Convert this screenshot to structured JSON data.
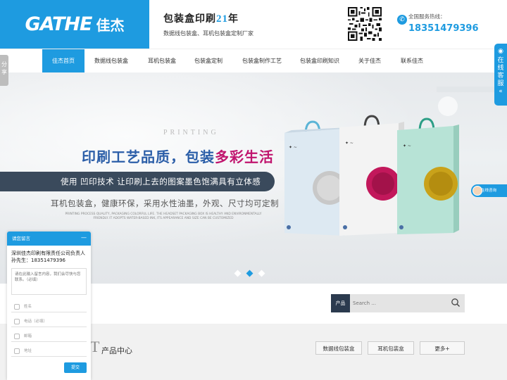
{
  "header": {
    "logo_text": "GATHE",
    "logo_cn": "佳杰",
    "slogan_title_pre": "包装盒印刷",
    "slogan_years": "21",
    "slogan_title_post": "年",
    "slogan_sub": "数据线包装盒、耳机包装盒定制厂家",
    "hotline_label": "全国服务热线：",
    "hotline_number": "18351479396"
  },
  "nav": {
    "items": [
      {
        "label": "佳杰首页"
      },
      {
        "label": "数据线包装盒"
      },
      {
        "label": "耳机包装盒"
      },
      {
        "label": "包装盒定制"
      },
      {
        "label": "包装盒制作工艺"
      },
      {
        "label": "包装盒印刷知识"
      },
      {
        "label": "关于佳杰"
      },
      {
        "label": "联系佳杰"
      }
    ],
    "active_index": 0
  },
  "banner": {
    "headline_a": "印刷工艺",
    "headline_b": "品质，包装",
    "headline_c": "多彩生活",
    "printing_word": "PRINTING",
    "bar_text": "使用 凹印技术 让印刷上去的图案墨色饱满具有立体感",
    "line2": "耳机包装盒，健康环保，采用水性油墨，外观、尺寸均可定制",
    "fine_print": "PRINTING PROCESS QUALITY, PACKAGING COLORFUL LIFE. THE HEADSET PACKAGING BOX IS HEALTHY AND ENVIRONMENTALLY FRIENDLY. IT ADOPTS WATER-BASED INK, ITS APPEARANCE AND SIZE CAN BE CUSTOMIZED",
    "slide_count": 3,
    "active_slide": 1
  },
  "search": {
    "category": "产品",
    "placeholder": "Search ..."
  },
  "products": {
    "title_letter": "T",
    "title": "产品中心",
    "tabs": [
      "数据线包装盒",
      "耳机包装盒",
      "更多+"
    ]
  },
  "side": {
    "share_label": "分享",
    "online_label": "在线客服",
    "consult_label": "在线咨询"
  },
  "message_widget": {
    "header": "请您留言",
    "intro_line1": "深圳佳杰印刷有限责任公司负责人",
    "intro_line2": "孙先生：18351479396",
    "textarea_placeholder": "请在此输入留言内容，我们会尽快与您联系。（必填）",
    "name_placeholder": "姓名",
    "phone_placeholder": "电话（必填）",
    "email_placeholder": "邮箱",
    "address_placeholder": "地址",
    "submit_label": "提交"
  },
  "colors": {
    "brand": "#1e9be0",
    "dark": "#2b3a4e",
    "accent_pink": "#c0156e"
  }
}
